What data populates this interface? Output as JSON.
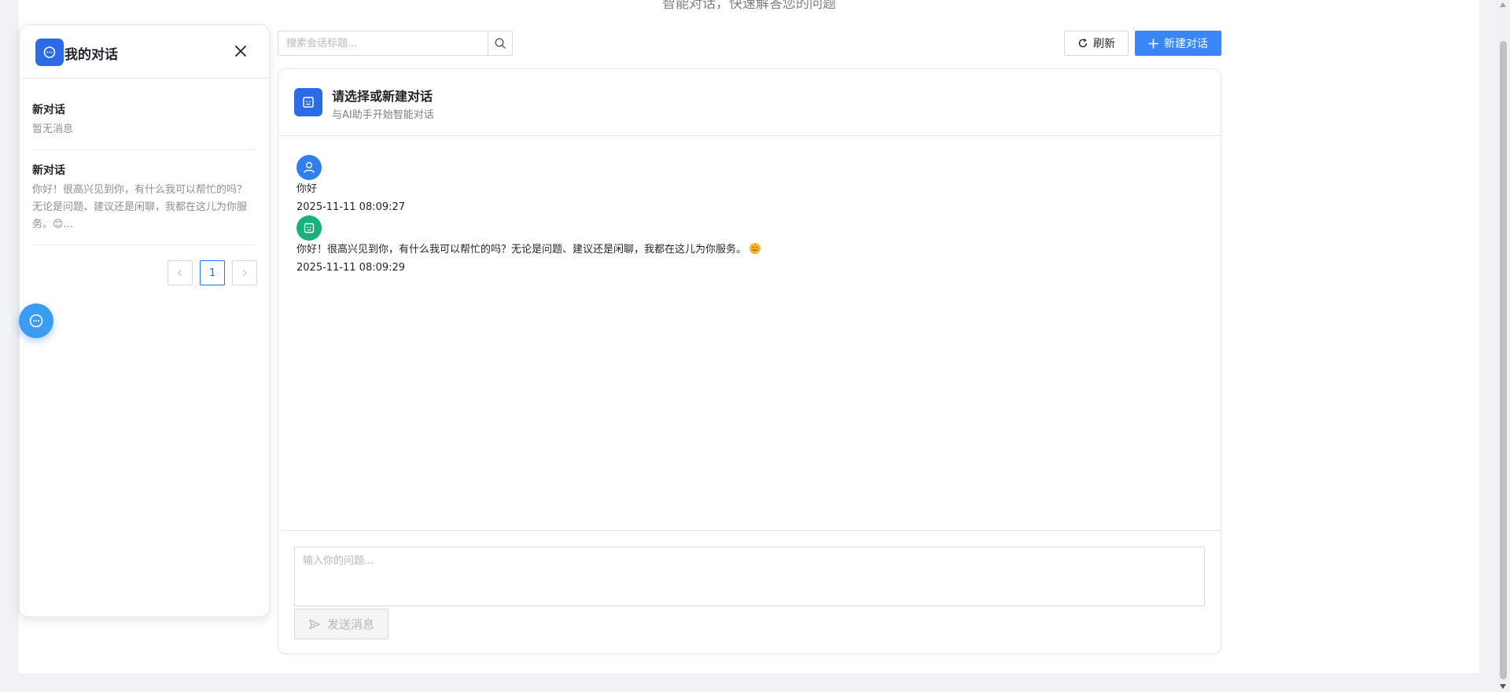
{
  "page": {
    "subtitle": "智能对话，快速解答您的问题"
  },
  "sidebar": {
    "title": "我的对话",
    "conversations": [
      {
        "title": "新对话",
        "preview": "暂无消息"
      },
      {
        "title": "新对话",
        "preview": "你好！很高兴见到你，有什么我可以帮忙的吗？无论是问题、建议还是闲聊，我都在这儿为你服务。😊..."
      }
    ],
    "pagination": {
      "current_page": "1"
    }
  },
  "toolbar": {
    "search_placeholder": "搜索会话标题...",
    "refresh_label": "刷新",
    "new_chat_label": "新建对话"
  },
  "chat": {
    "title": "请选择或新建对话",
    "subtitle": "与AI助手开始智能对话",
    "messages": [
      {
        "role": "user",
        "text": "你好",
        "time": "2025-11-11 08:09:27"
      },
      {
        "role": "assistant",
        "text": "你好！很高兴见到你，有什么我可以帮忙的吗？无论是问题、建议还是闲聊，我都在这儿为你服务。",
        "time": "2025-11-11 08:09:29"
      }
    ],
    "input_placeholder": "输入你的问题...",
    "send_label": "发送消息"
  },
  "colors": {
    "primary": "#3a86f6",
    "brand_icon": "#2b6be6",
    "user_avatar": "#2f80ed",
    "bot_avatar": "#19b07a",
    "fab": "#3b9cf4"
  }
}
